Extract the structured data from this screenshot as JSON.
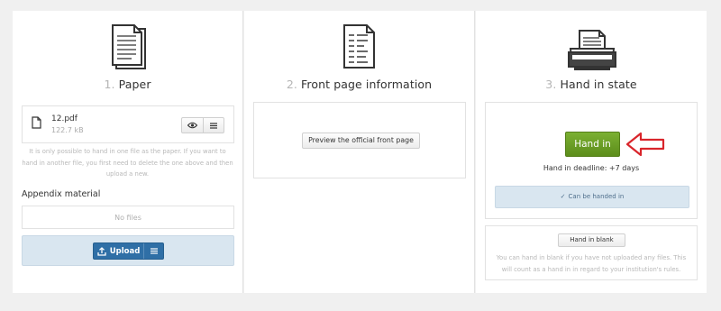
{
  "paper": {
    "step": "1.",
    "title": "Paper",
    "file": {
      "name": "12.pdf",
      "size": "122.7 kB"
    },
    "note": "It is only possible to hand in one file as the paper. If you want to hand in another file, you first need to delete the one above and then upload a new.",
    "appendix_label": "Appendix material",
    "appendix_empty": "No files",
    "upload_label": "Upload"
  },
  "front_page": {
    "step": "2.",
    "title": "Front page information",
    "preview_label": "Preview the official front page"
  },
  "hand_in": {
    "step": "3.",
    "title": "Hand in state",
    "button_label": "Hand in",
    "deadline": "Hand in deadline: +7 days",
    "status": "Can be handed in",
    "blank_label": "Hand in blank",
    "blank_note": "You can hand in blank if you have not uploaded any files. This will count as a hand in in regard to your institution's rules."
  },
  "icons": {
    "paper": "paper-document-icon",
    "front_page": "front-page-form-icon",
    "hand_in": "inbox-tray-icon",
    "file": "file-icon",
    "view": "eye-icon",
    "menu": "hamburger-menu-icon",
    "upload": "upload-icon",
    "check": "checkmark-icon",
    "arrow": "red-arrow-pointer-icon"
  },
  "colors": {
    "hand_in_button": "#6a9f25",
    "upload_button": "#2f6fa6",
    "status_bg": "#d9e6f0",
    "arrow": "#d9252b"
  }
}
